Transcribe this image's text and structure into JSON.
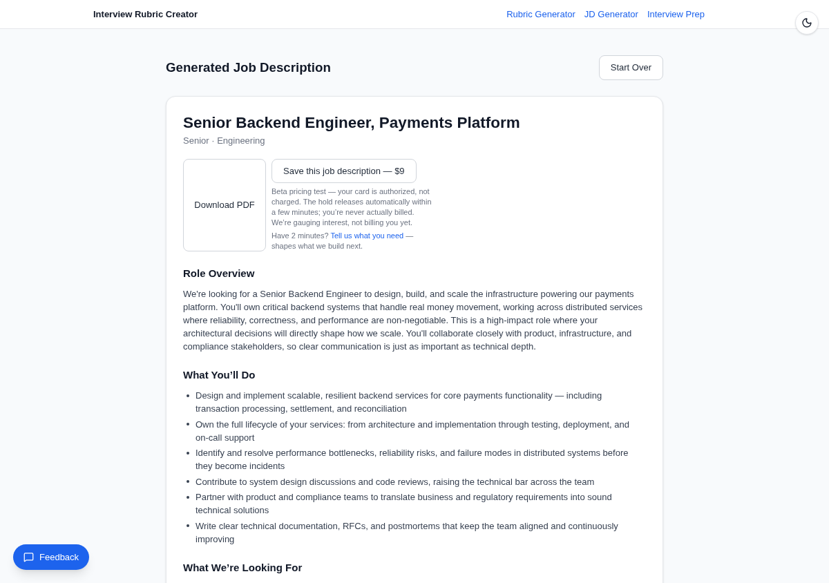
{
  "header": {
    "brand": "Interview Rubric Creator",
    "nav": [
      {
        "label": "Rubric Generator"
      },
      {
        "label": "JD Generator"
      },
      {
        "label": "Interview Prep"
      }
    ]
  },
  "page": {
    "title": "Generated Job Description",
    "start_over": "Start Over"
  },
  "job": {
    "title": "Senior Backend Engineer, Payments Platform",
    "meta": "Senior · Engineering",
    "download": "Download PDF",
    "save": "Save this job description — $9",
    "notice": "Beta pricing test — your card is authorized, not charged. The hold releases automatically within a few minutes; you’re never actually billed.",
    "notice_note": "We’re gauging interest, not billing you yet.",
    "prompt": {
      "before": "Have 2 minutes?",
      "link": "Tell us what you need",
      "after": "— shapes what we build next."
    }
  },
  "sections": [
    {
      "kind": "paragraph",
      "heading": "Role Overview",
      "text": "We're looking for a Senior Backend Engineer to design, build, and scale the infrastructure powering our payments platform. You'll own critical backend systems that handle real money movement, working across distributed services where reliability, correctness, and performance are non-negotiable. This is a high-impact role where your architectural decisions will directly shape how we scale. You'll collaborate closely with product, infrastructure, and compliance stakeholders, so clear communication is just as important as technical depth."
    },
    {
      "kind": "list",
      "heading": "What You’ll Do",
      "items": [
        "Design and implement scalable, resilient backend services for core payments functionality — including transaction processing, settlement, and reconciliation",
        "Own the full lifecycle of your services: from architecture and implementation through testing, deployment, and on-call support",
        "Identify and resolve performance bottlenecks, reliability risks, and failure modes in distributed systems before they become incidents",
        "Contribute to system design discussions and code reviews, raising the technical bar across the team",
        "Partner with product and compliance teams to translate business and regulatory requirements into sound technical solutions",
        "Write clear technical documentation, RFCs, and postmortems that keep the team aligned and continuously improving"
      ]
    },
    {
      "kind": "list",
      "heading": "What We’re Looking For"
    }
  ],
  "feedback_button": {
    "label": "Feedback"
  }
}
